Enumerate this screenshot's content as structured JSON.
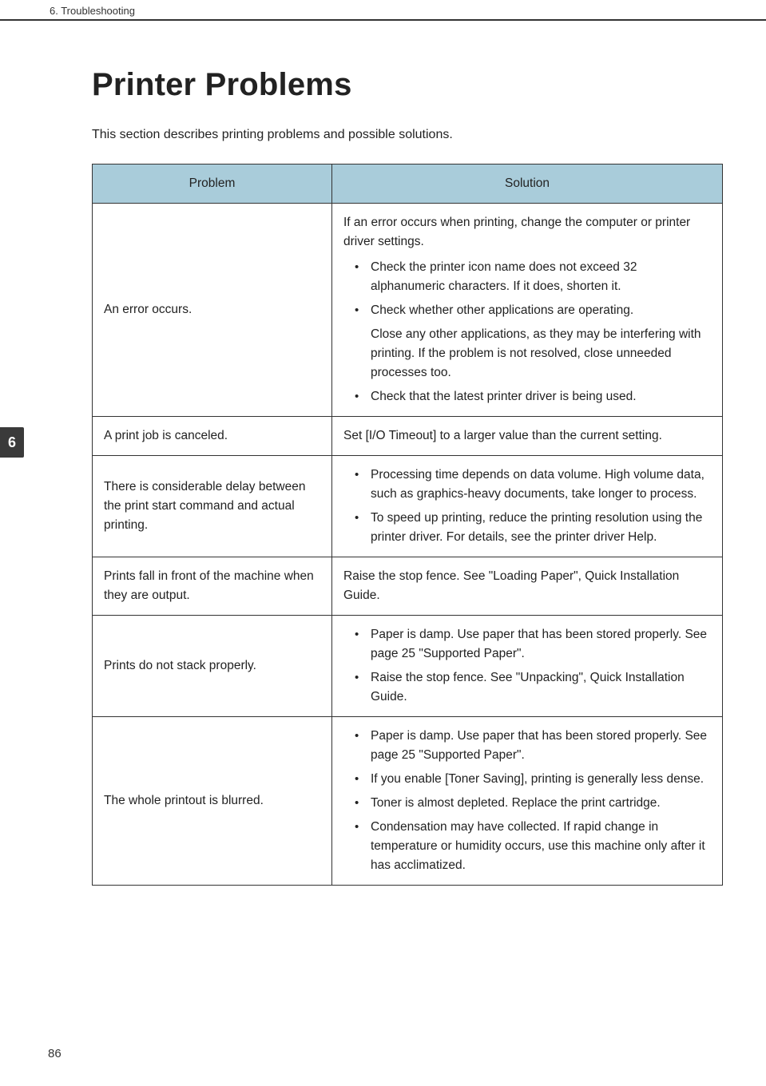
{
  "running_head": "6. Troubleshooting",
  "side_tab": "6",
  "page_number": "86",
  "title": "Printer Problems",
  "intro": "This section describes printing problems and possible solutions.",
  "table": {
    "header": {
      "problem": "Problem",
      "solution": "Solution"
    },
    "rows": [
      {
        "problem": "An error occurs.",
        "solution_pre": "If an error occurs when printing, change the computer or printer driver settings.",
        "bullets": [
          {
            "text": "Check the printer icon name does not exceed 32 alphanumeric characters. If it does, shorten it."
          },
          {
            "text": "Check whether other applications are operating.",
            "sub": "Close any other applications, as they may be interfering with printing. If the problem is not resolved, close unneeded processes too."
          },
          {
            "text": "Check that the latest printer driver is being used."
          }
        ]
      },
      {
        "problem": "A print job is canceled.",
        "solution_plain": "Set [I/O Timeout] to a larger value than the current setting."
      },
      {
        "problem": "There is considerable delay between the print start command and actual printing.",
        "bullets": [
          {
            "text": "Processing time depends on data volume. High volume data, such as graphics-heavy documents, take longer to process."
          },
          {
            "text": "To speed up printing, reduce the printing resolution using the printer driver. For details, see the printer driver Help."
          }
        ]
      },
      {
        "problem": "Prints fall in front of the machine when they are output.",
        "solution_plain": "Raise the stop fence. See \"Loading Paper\", Quick Installation Guide."
      },
      {
        "problem": "Prints do not stack properly.",
        "bullets": [
          {
            "text": "Paper is damp. Use paper that has been stored properly. See page 25 \"Supported Paper\"."
          },
          {
            "text": "Raise the stop fence. See \"Unpacking\", Quick Installation Guide."
          }
        ]
      },
      {
        "problem": "The whole printout is blurred.",
        "bullets": [
          {
            "text": "Paper is damp. Use paper that has been stored properly. See page 25 \"Supported Paper\"."
          },
          {
            "text": "If you enable [Toner Saving], printing is generally less dense."
          },
          {
            "text": "Toner is almost depleted. Replace the print cartridge."
          },
          {
            "text": "Condensation may have collected. If rapid change in temperature or humidity occurs, use this machine only after it has acclimatized."
          }
        ]
      }
    ]
  }
}
